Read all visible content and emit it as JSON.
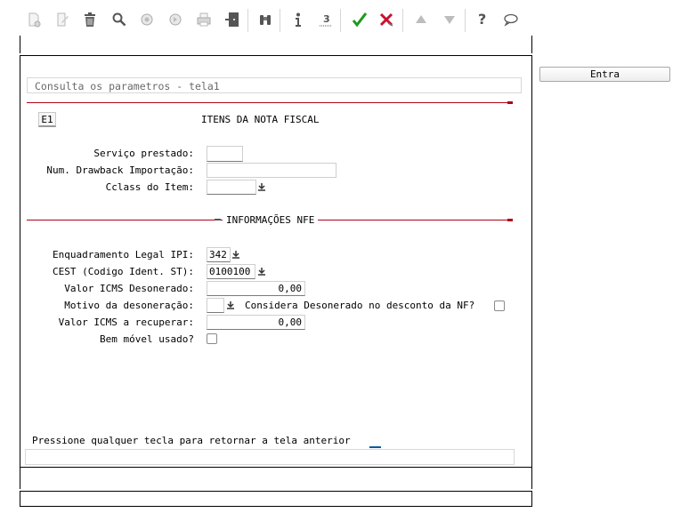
{
  "toolbar": {
    "buttons": [
      {
        "icon": "new-document-icon"
      },
      {
        "icon": "edit-document-icon"
      },
      {
        "icon": "trash-icon"
      },
      {
        "icon": "search-icon"
      },
      {
        "icon": "previous-icon"
      },
      {
        "icon": "next-icon"
      },
      {
        "icon": "print-icon"
      },
      {
        "icon": "exit-icon"
      },
      {
        "icon": "binoculars-icon"
      },
      {
        "icon": "info-icon"
      },
      {
        "icon": "hint-icon"
      },
      {
        "icon": "confirm-icon"
      },
      {
        "icon": "cancel-icon"
      },
      {
        "icon": "up-arrow-icon"
      },
      {
        "icon": "down-arrow-icon"
      },
      {
        "icon": "help-icon"
      },
      {
        "icon": "comment-icon"
      }
    ]
  },
  "screen": {
    "title": "Consulta os parametros - tela1",
    "e1_label": "E1",
    "heading": "ITENS DA NOTA FISCAL",
    "servico_label": "Serviço prestado:",
    "servico_value": "",
    "drawback_label": "Num. Drawback Importação:",
    "drawback_value": "",
    "cclass_label": "Cclass do Item:",
    "cclass_value": "",
    "section_nfe": "INFORMAÇÕES NFE",
    "enquadramento_label": "Enquadramento Legal IPI:",
    "enquadramento_value": "342",
    "cest_label": "CEST (Codigo Ident. ST):",
    "cest_value": "0100100",
    "valor_icms_deson_label": "Valor ICMS Desonerado:",
    "valor_icms_deson_value": "0,00",
    "motivo_label": "Motivo da desoneração:",
    "motivo_value": "",
    "considera_label": "Considera Desonerado no desconto da NF?",
    "considera_checked": false,
    "valor_icms_recup_label": "Valor ICMS a recuperar:",
    "valor_icms_recup_value": "0,00",
    "bem_movel_label": "Bem móvel usado?",
    "bem_movel_checked": false,
    "prompt": "Pressione qualquer tecla para retornar a tela anterior"
  },
  "side": {
    "entra_label": "Entra"
  },
  "colors": {
    "red_rule": "#b0001a",
    "confirm_green": "#1a9a1a",
    "cancel_red": "#c8102e",
    "cursor_blue": "#0a5a9c"
  }
}
